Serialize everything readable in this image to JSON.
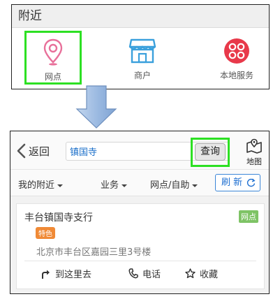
{
  "top_panel": {
    "title": "附近",
    "categories": [
      {
        "label": "网点",
        "icon": "location-pin-icon"
      },
      {
        "label": "商户",
        "icon": "storefront-icon"
      },
      {
        "label": "本地服务",
        "icon": "services-icon"
      }
    ]
  },
  "bottom_panel": {
    "navbar": {
      "back_label": "返回",
      "search_value": "镇国寺",
      "query_label": "查询",
      "map_label": "地图"
    },
    "filters": [
      "我的附近",
      "业务",
      "网点/自助"
    ],
    "refresh_label": "刷 新",
    "result": {
      "name": "丰台镇国寺支行",
      "type": "网点",
      "tag": "特色",
      "address": "北京市丰台区嘉园三里3号楼",
      "actions": [
        "到这里去",
        "电话",
        "收藏"
      ]
    }
  },
  "colors": {
    "highlight": "#2de023",
    "pin": "#e8709a",
    "store": "#3aa0dc",
    "services": "#e8394a",
    "brand_blue": "#1e6fd1",
    "tag_orange": "#f08a36",
    "badge_green": "#7ec365"
  }
}
